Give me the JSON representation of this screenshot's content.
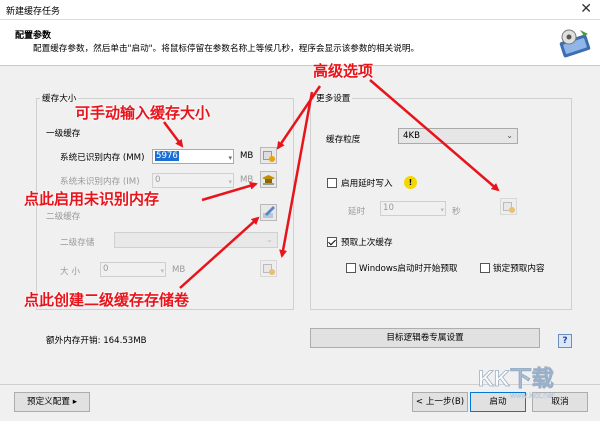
{
  "window": {
    "title": "新建缓存任务",
    "close": "✕"
  },
  "header": {
    "title": "配置参数",
    "desc": "配置缓存参数，然后单击\"启动\"。将鼠标停留在参数名称上等候几秒，程序会显示该参数的相关说明。"
  },
  "left_group": {
    "label": "缓存大小",
    "level1": {
      "label": "一级缓存",
      "recognized_label": "系统已识别内存 (MM)",
      "recognized_value": "5976",
      "unit": "MB",
      "unrecognized_label": "系统未识别内存 (IM)",
      "unrecognized_value": "0",
      "unit2": "MB"
    },
    "level2": {
      "label": "二级缓存",
      "storage_label": "二级存储",
      "storage_value": "",
      "size_label": "大 小",
      "size_value": "0",
      "unit": "MB"
    }
  },
  "right_group": {
    "label": "更多设置",
    "granularity_label": "缓存粒度",
    "granularity_value": "4KB",
    "delay_write_label": "启用延时写入",
    "delay_label": "延时",
    "delay_value": "10",
    "delay_unit": "秒",
    "prefetch_label": "预取上次缓存",
    "prefetch_checked": true,
    "start_prefetch_label": "Windows启动时开始预取",
    "lock_prefetch_label": "锁定预取内容"
  },
  "extra_memory": "额外内存开销: 164.53MB",
  "target_btn": "目标逻辑卷专属设置",
  "help": "?",
  "footer": {
    "preset": "预定义配置",
    "preset_arrow": "▸",
    "back": "< 上一步(B)",
    "start": "启动",
    "cancel": "取消"
  },
  "annotations": {
    "a1": "可手动输入缓存大小",
    "a2": "高级选项",
    "a3": "点此启用未识别内存",
    "a4": "点此创建二级缓存存储卷"
  },
  "watermark": {
    "text": "KK下载",
    "url": "www.kkx.net"
  },
  "colors": {
    "annotation": "#e8141b",
    "selection": "#1a6fd6",
    "accent": "#0078d7"
  }
}
